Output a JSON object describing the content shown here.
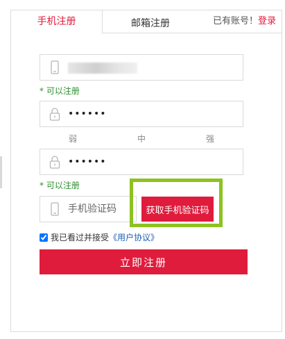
{
  "tabs": [
    {
      "label": "手机注册",
      "active": true
    },
    {
      "label": "邮箱注册",
      "active": false
    }
  ],
  "login_hint": {
    "text": "已有账号！",
    "link": "登录"
  },
  "phone": {
    "value_redacted": true,
    "icon": "mobile-phone-icon"
  },
  "phone_hint": "* 可以注册",
  "password": {
    "value": "••••••",
    "icon": "lock-icon"
  },
  "strength": [
    "弱",
    "中",
    "强"
  ],
  "confirm_password": {
    "value": "••••••",
    "icon": "lock-icon"
  },
  "confirm_hint": "* 可以注册",
  "sms": {
    "placeholder": "手机验证码",
    "button": "获取手机验证码",
    "icon": "mobile-phone-icon"
  },
  "agreement": {
    "checked": true,
    "text": "我已看过并接受",
    "link": "《用户协议》"
  },
  "submit": "立即注册",
  "colors": {
    "accent": "#e01c3c",
    "ok": "#2f8e2f",
    "highlight": "#8dc21f",
    "link": "#1a5fb4"
  }
}
